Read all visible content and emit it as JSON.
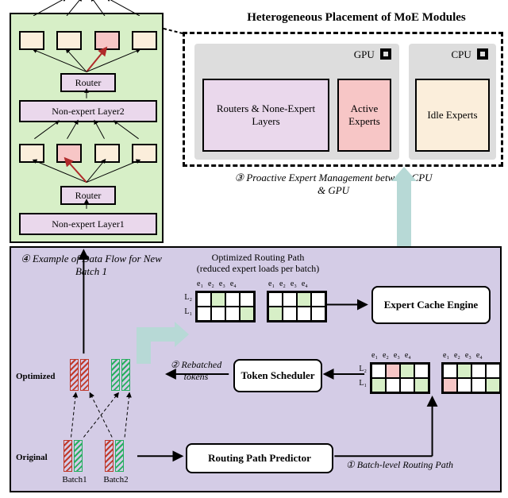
{
  "hetero": {
    "title": "Heterogeneous Placement of MoE Modules",
    "gpu": {
      "label": "GPU",
      "box1": "Routers & None-Expert Layers",
      "box2": "Active Experts"
    },
    "cpu": {
      "label": "CPU",
      "box1": "Idle Experts"
    }
  },
  "moe": {
    "router": "Router",
    "layer1": "Non-expert Layer1",
    "layer2": "Non-expert Layer2"
  },
  "steps": {
    "s1": "① Batch-level Routing Path",
    "s2": "② Rebatched tokens",
    "s3": "③ Proactive Expert Management between CPU & GPU",
    "s4": "④ Example of Data Flow for New Batch 1"
  },
  "opt_path": {
    "title": "Optimized Routing Path",
    "subtitle": "(reduced expert loads per batch)",
    "columns": [
      "e₁",
      "e₂",
      "e₃",
      "e₄"
    ],
    "rows": [
      "L₂",
      "L₁"
    ]
  },
  "grid_optA": [
    [
      "-",
      "g",
      "-",
      "-"
    ],
    [
      "-",
      "-",
      "-",
      "g"
    ]
  ],
  "grid_optB": [
    [
      "-",
      "-",
      "g",
      "-"
    ],
    [
      "g",
      "-",
      "-",
      "-"
    ]
  ],
  "grid_origA": [
    [
      "-",
      "p",
      "g",
      "-"
    ],
    [
      "g",
      "-",
      "-",
      "g"
    ]
  ],
  "grid_origB": [
    [
      "-",
      "g",
      "-",
      "-"
    ],
    [
      "p",
      "-",
      "-",
      "g"
    ]
  ],
  "components": {
    "cache": "Expert Cache Engine",
    "scheduler": "Token Scheduler",
    "predictor": "Routing Path Predictor"
  },
  "batches": {
    "labelA": "Batch1",
    "labelB": "Batch2",
    "rowOpt": "Optimized",
    "rowOrig": "Original"
  },
  "chart_data": {
    "type": "diagram",
    "note": "System overview diagram (MoE offloading). No quantitative axes."
  }
}
